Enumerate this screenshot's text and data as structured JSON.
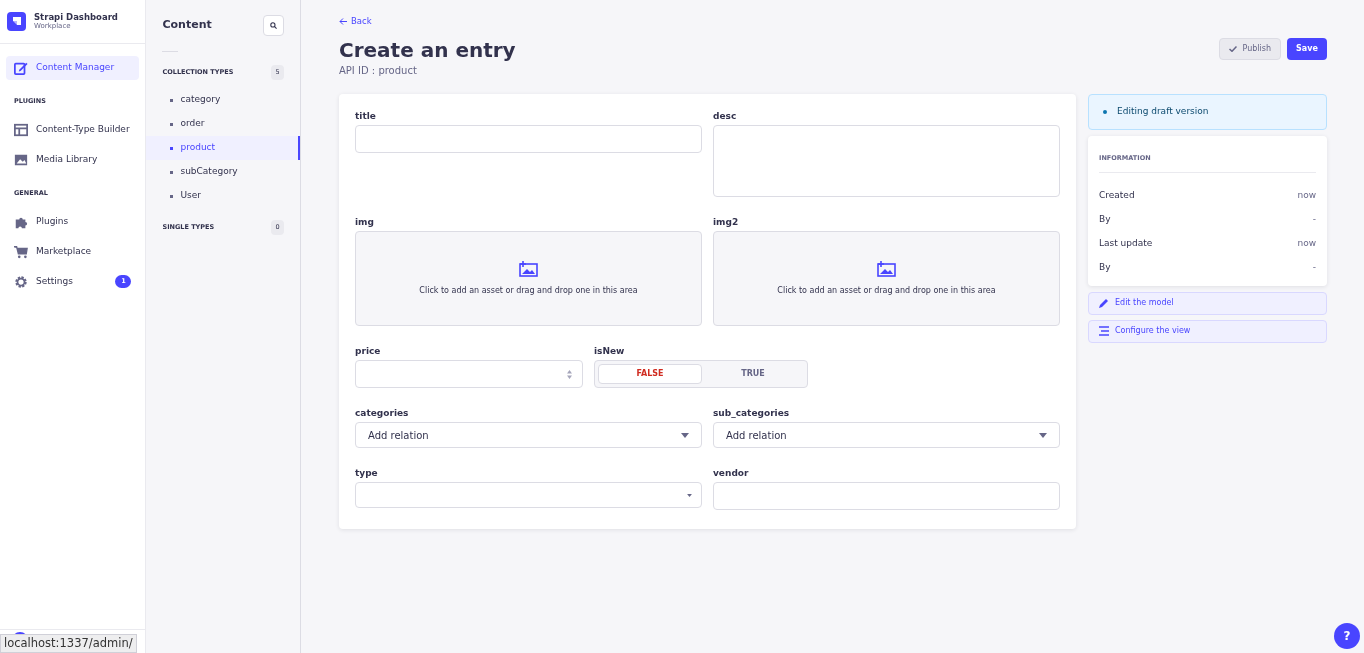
{
  "brand": {
    "title": "Strapi Dashboard",
    "subtitle": "Workplace"
  },
  "nav": [
    {
      "kind": "item",
      "label": "Content Manager",
      "selected": true
    },
    {
      "kind": "section",
      "label": "PLUGINS"
    },
    {
      "kind": "item",
      "label": "Content-Type Builder",
      "selected": false
    },
    {
      "kind": "item",
      "label": "Media Library",
      "selected": false
    },
    {
      "kind": "section",
      "label": "GENERAL"
    },
    {
      "kind": "item",
      "label": "Plugins",
      "selected": false
    },
    {
      "kind": "item",
      "label": "Marketplace",
      "selected": false
    },
    {
      "kind": "item",
      "label": "Settings",
      "selected": false,
      "badge": "1"
    }
  ],
  "status_tooltip": "localhost:1337/admin/",
  "content_panel": {
    "title": "Content",
    "groups": [
      {
        "label": "COLLECTION TYPES",
        "count": "5",
        "items": [
          {
            "label": "category",
            "selected": false
          },
          {
            "label": "order",
            "selected": false
          },
          {
            "label": "product",
            "selected": true
          },
          {
            "label": "subCategory",
            "selected": false
          },
          {
            "label": "User",
            "selected": false
          }
        ]
      },
      {
        "label": "SINGLE TYPES",
        "count": "0"
      }
    ]
  },
  "header": {
    "back": "Back",
    "title": "Create an entry",
    "subtitle": "API ID : product",
    "publish": "Publish",
    "save": "Save"
  },
  "form_rows": [
    [
      {
        "kind": "text",
        "label": "title"
      },
      {
        "kind": "textarea",
        "label": "desc"
      }
    ],
    [
      {
        "kind": "media",
        "label": "img",
        "hint": "Click to add an asset or drag and drop one in this area"
      },
      {
        "kind": "media",
        "label": "img2",
        "hint": "Click to add an asset or drag and drop one in this area"
      }
    ],
    [
      {
        "kind": "number",
        "label": "price"
      },
      {
        "kind": "boolean",
        "label": "isNew",
        "options": [
          {
            "label": "FALSE",
            "selected": true
          },
          {
            "label": "TRUE",
            "selected": false
          }
        ]
      }
    ],
    [
      {
        "kind": "relation",
        "label": "categories",
        "placeholder": "Add relation"
      },
      {
        "kind": "relation",
        "label": "sub_categories",
        "placeholder": "Add relation"
      }
    ],
    [
      {
        "kind": "select",
        "label": "type"
      },
      {
        "kind": "text",
        "label": "vendor"
      }
    ]
  ],
  "status": "Editing draft version",
  "information": {
    "title": "INFORMATION",
    "rows": [
      {
        "label": "Created",
        "value": "now"
      },
      {
        "label": "By",
        "value": "-"
      },
      {
        "label": "Last update",
        "value": "now"
      },
      {
        "label": "By",
        "value": "-"
      }
    ]
  },
  "links": [
    {
      "label": "Edit the model"
    },
    {
      "label": "Configure the view"
    }
  ],
  "help": "?"
}
